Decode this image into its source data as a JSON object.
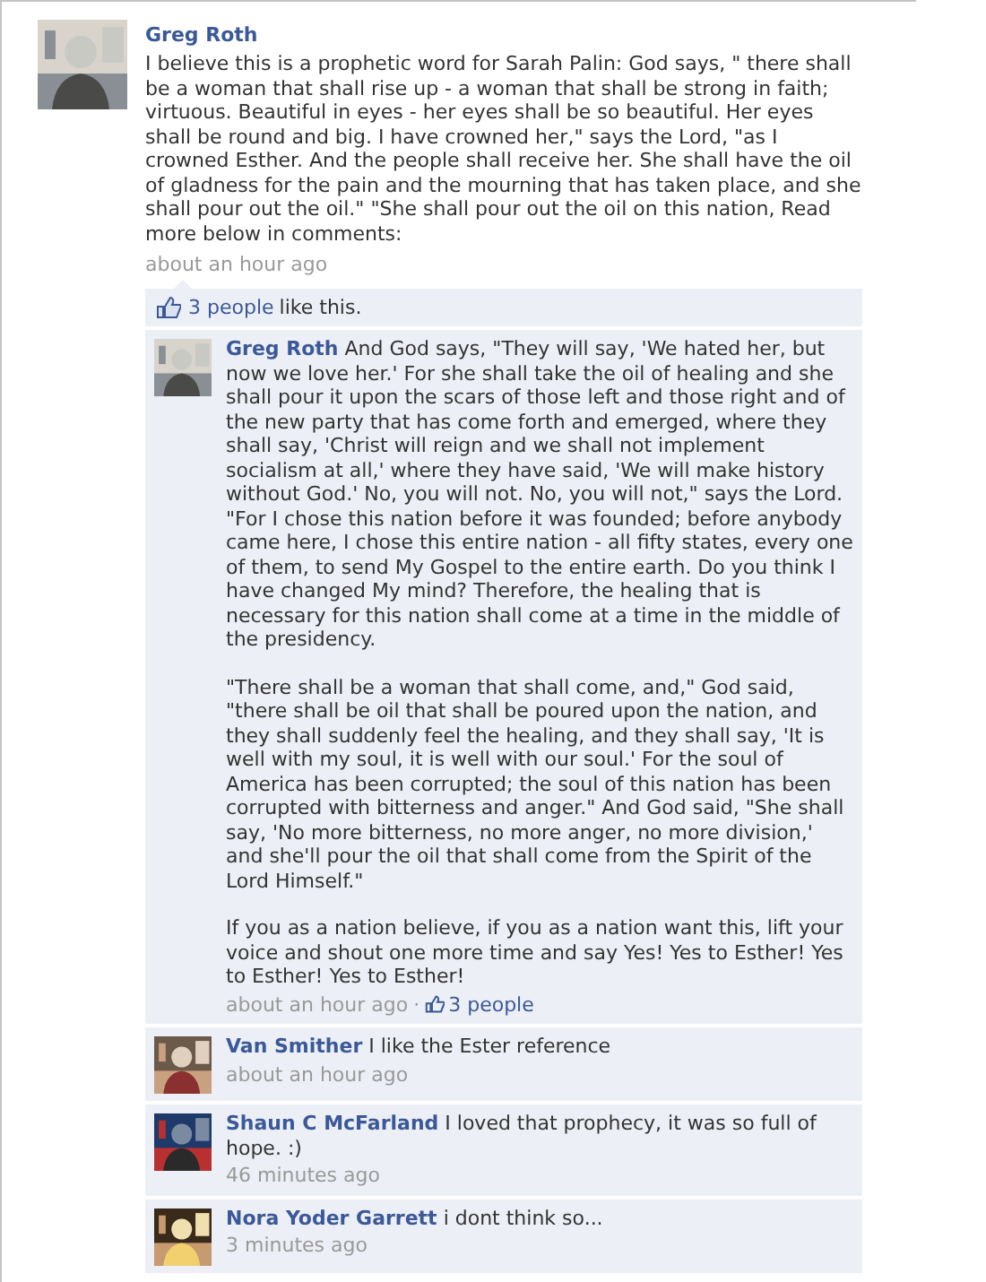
{
  "post": {
    "author": "Greg Roth",
    "text": "I believe this is a prophetic word for Sarah Palin: God says, \" there shall be a woman that shall rise up - a woman that shall be strong in faith; virtuous. Beautiful in eyes - her eyes shall be so beautiful. Her eyes shall be round and big. I have crowned her,\" says the Lord, \"as I crowned Esther. And the people shall receive her. She shall have the oil of gladness for the pain and the mourning that has taken place, and she shall pour out the oil.\" \"She shall pour out the oil on this nation, Read more below in comments:",
    "time": "about an hour ago"
  },
  "likes": {
    "link": "3 people",
    "text": "like this."
  },
  "comments": [
    {
      "author": "Greg Roth",
      "paragraphs": [
        "And God says, \"They will say, 'We hated her, but now we love her.' For she shall take the oil of healing and she shall pour it upon the scars of those left and those right and of the new party that has come forth and emerged, where they shall say, 'Christ will reign and we shall not implement socialism at all,' where they have said, 'We will make history without God.' No, you will not. No, you will not,\" says the Lord. \"For I chose this nation before it was founded; before anybody came here, I chose this entire nation - all fifty states, every one of them, to send My Gospel to the entire earth. Do you think I have changed My mind? Therefore, the healing that is necessary for this nation shall come at a time in the middle of the presidency.",
        "\"There shall be a woman that shall come, and,\" God said, \"there shall be oil that shall be poured upon the nation, and they shall suddenly feel the healing, and they shall say, 'It is well with my soul, it is well with our soul.' For the soul of America has been corrupted; the soul of this nation has been corrupted with bitterness and anger.\" And God said, \"She shall say, 'No more bitterness, no more anger, no more division,' and she'll pour the oil that shall come from the Spirit of the Lord Himself.\"",
        "If you as a nation believe, if you as a nation want this, lift your voice and shout one more time and say Yes! Yes to Esther! Yes to Esther! Yes to Esther!"
      ],
      "time": "about an hour ago",
      "separator": "·",
      "likes": "3 people"
    },
    {
      "author": "Van Smither",
      "paragraphs": [
        "I like the Ester reference"
      ],
      "time": "about an hour ago"
    },
    {
      "author": "Shaun C McFarland",
      "paragraphs": [
        "I loved that prophecy, it was so full of hope. :)"
      ],
      "time": "46 minutes ago"
    },
    {
      "author": "Nora Yoder Garrett",
      "paragraphs": [
        "i dont think so..."
      ],
      "time": "3 minutes ago"
    }
  ]
}
